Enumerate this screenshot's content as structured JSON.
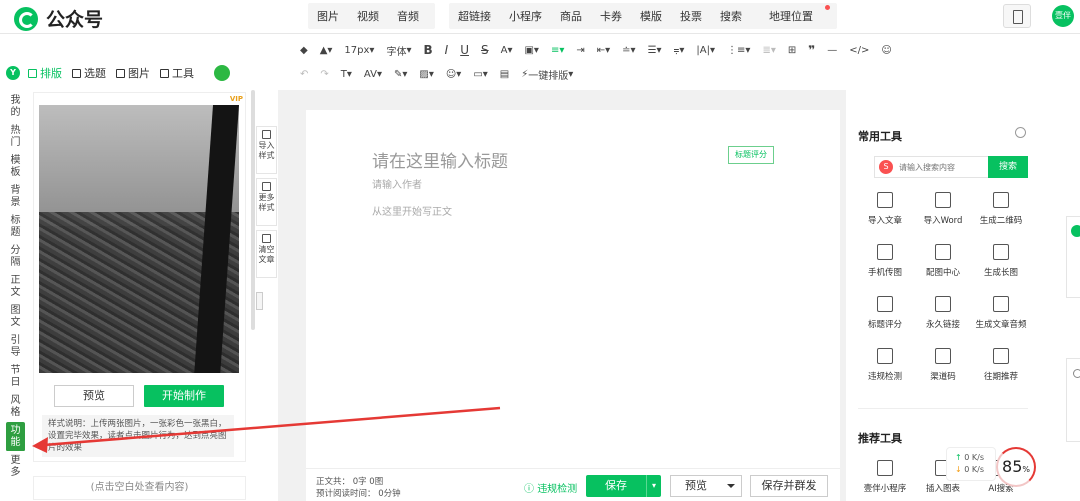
{
  "app": {
    "name": "公众号",
    "user_label": "壹伴"
  },
  "topnav": {
    "group1": [
      "图片",
      "视频",
      "音频"
    ],
    "group2": [
      "超链接",
      "小程序",
      "商品",
      "卡券",
      "模版",
      "投票",
      "搜索",
      "地理位置"
    ]
  },
  "format_toolbar": {
    "font_size": "17px",
    "font_label": "字体",
    "one_click_layout": "一键排版"
  },
  "left_tabs": [
    {
      "label": "排版",
      "active": true
    },
    {
      "label": "选题",
      "active": false
    },
    {
      "label": "图片",
      "active": false
    },
    {
      "label": "工具",
      "active": false
    }
  ],
  "categories": [
    "我的",
    "热门",
    "模板",
    "背景",
    "标题",
    "分隔",
    "正文",
    "图文",
    "引导",
    "节日",
    "风格",
    "功能",
    "更多"
  ],
  "active_category": "功能",
  "template_card": {
    "vip_label": "VIP",
    "preview_label": "预览",
    "make_label": "开始制作",
    "description": "样式说明：上传两张图片，一张彩色一张黑白，设置完毕效果，读者点击图片行为，达到点亮图片的效果",
    "more_hint": "(点击空白处查看内容)"
  },
  "side_tools": [
    "导入样式",
    "更多样式",
    "清空文章"
  ],
  "editor": {
    "title_placeholder": "请在这里输入标题",
    "title_score": "标题评分",
    "author_placeholder": "请输入作者",
    "body_placeholder": "从这里开始写正文"
  },
  "bottom_bar": {
    "word_count": "正文共： 0字 0图",
    "read_time": "预计阅读时间： 0分钟",
    "violation_check": "违规检测",
    "save": "保存",
    "preview": "预览",
    "save_group": "保存并群发"
  },
  "right_panel": {
    "common_title": "常用工具",
    "search_placeholder": "请输入搜索内容",
    "search_button": "搜索",
    "tools": [
      "导入文章",
      "导入Word",
      "生成二维码",
      "手机传图",
      "配图中心",
      "生成长图",
      "标题评分",
      "永久链接",
      "生成文章音频",
      "违规检测",
      "渠道码",
      "往期推荐"
    ],
    "recommend_title": "推荐工具",
    "recommend_tools": [
      "壹伴小程序",
      "插入图表",
      "AI搜索"
    ]
  },
  "net_monitor": {
    "up": "0  K/s",
    "down": "0  K/s"
  },
  "gauge": {
    "value": "85",
    "unit": "%"
  },
  "colors": {
    "brand": "#07c160",
    "arrow": "#e53935"
  }
}
